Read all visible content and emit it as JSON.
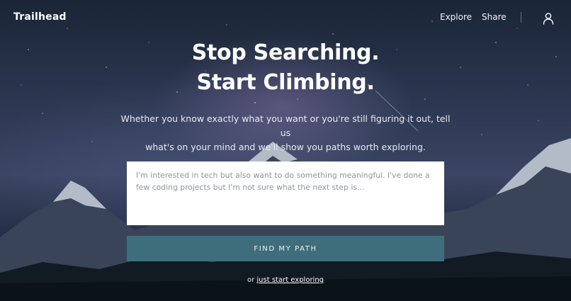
{
  "nav": {
    "brand": "Trailhead",
    "links": [
      {
        "label": "Explore"
      },
      {
        "label": "Share"
      }
    ],
    "account_icon": "user-icon"
  },
  "hero": {
    "title_line1": "Stop Searching.",
    "title_line2": "Start Climbing.",
    "subtitle_line1": "Whether you know exactly what you want or you're still figuring it out, tell us",
    "subtitle_line2": "what's on your mind and we'll show you paths worth exploring."
  },
  "prompt": {
    "value": "",
    "placeholder": "I'm interested in tech but also want to do something meaningful. I've done a few coding projects but I'm not sure what the next step is..."
  },
  "cta": {
    "label": "FIND MY PATH",
    "color": "#3e6e7b"
  },
  "alt": {
    "prefix": "or",
    "link_label": "just start exploring"
  }
}
